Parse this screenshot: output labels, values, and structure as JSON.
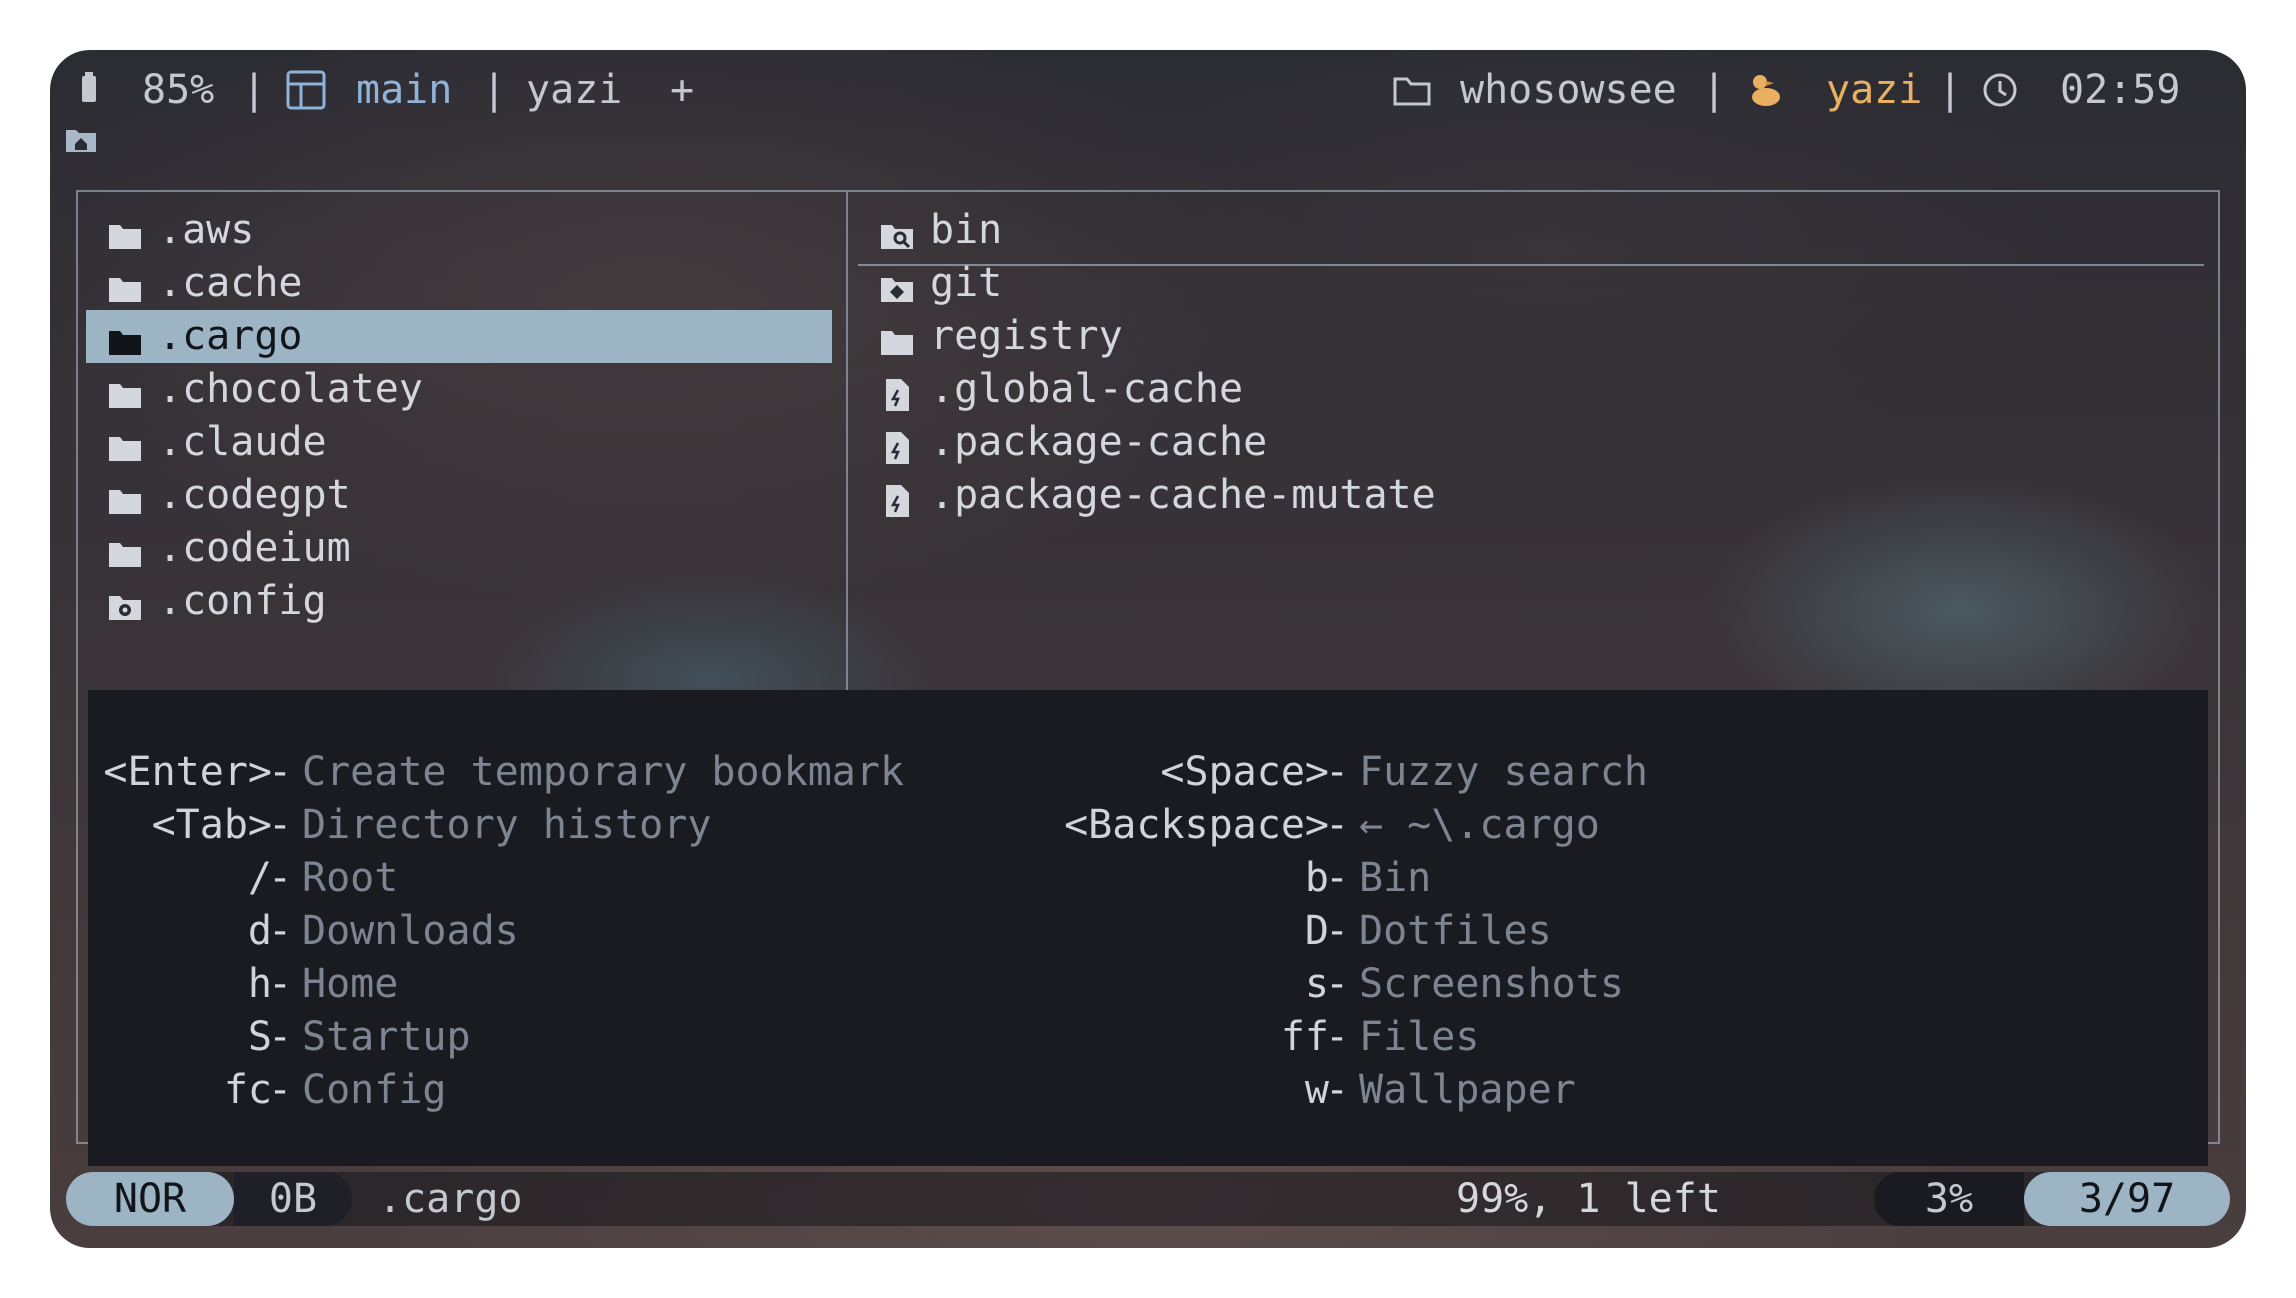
{
  "topbar": {
    "battery_icon": "battery-icon",
    "battery": "85%",
    "sep1": "|",
    "layout_icon": "layout-grid-icon",
    "session": "main",
    "sep2": "|",
    "tab": "yazi",
    "plus": "+",
    "folder_icon": "folder-outline-icon",
    "user": "whosowsee",
    "sep3": "|",
    "app_icon": "duck-icon",
    "app": "yazi",
    "sep4": "|",
    "clock_icon": "clock-icon",
    "time": "02:59"
  },
  "header": {
    "home_icon": "home-icon"
  },
  "left_pane": {
    "items": [
      {
        "name": ".aws",
        "icon": "folder-icon"
      },
      {
        "name": ".cache",
        "icon": "folder-icon"
      },
      {
        "name": ".cargo",
        "icon": "folder-icon",
        "selected": true
      },
      {
        "name": ".chocolatey",
        "icon": "folder-icon"
      },
      {
        "name": ".claude",
        "icon": "folder-icon"
      },
      {
        "name": ".codegpt",
        "icon": "folder-icon"
      },
      {
        "name": ".codeium",
        "icon": "folder-icon"
      },
      {
        "name": ".config",
        "icon": "folder-gear-icon"
      }
    ]
  },
  "right_pane": {
    "items": [
      {
        "name": "bin",
        "icon": "folder-search-icon"
      },
      {
        "name": "git",
        "icon": "folder-git-icon"
      },
      {
        "name": "registry",
        "icon": "folder-icon"
      },
      {
        "name": ".global-cache",
        "icon": "file-icon"
      },
      {
        "name": ".package-cache",
        "icon": "file-icon"
      },
      {
        "name": ".package-cache-mutate",
        "icon": "file-icon"
      }
    ]
  },
  "help": {
    "left": [
      {
        "key": "<Enter>",
        "dash": "-",
        "desc": "Create temporary bookmark"
      },
      {
        "key": "<Tab>",
        "dash": "-",
        "desc": "Directory history"
      },
      {
        "key": "/",
        "dash": "-",
        "desc": "Root"
      },
      {
        "key": "d",
        "dash": "-",
        "desc": "Downloads"
      },
      {
        "key": "h",
        "dash": "-",
        "desc": "Home"
      },
      {
        "key": "S",
        "dash": "-",
        "desc": "Startup"
      },
      {
        "key": "fc",
        "dash": "-",
        "desc": "Config"
      }
    ],
    "right": [
      {
        "key": "<Space>",
        "dash": "-",
        "desc": "Fuzzy search"
      },
      {
        "key": "<Backspace>",
        "dash": "-",
        "desc": "← ~\\.cargo"
      },
      {
        "key": "b",
        "dash": "-",
        "desc": "Bin"
      },
      {
        "key": "D",
        "dash": "-",
        "desc": "Dotfiles"
      },
      {
        "key": "s",
        "dash": "-",
        "desc": "Screenshots"
      },
      {
        "key": "ff",
        "dash": "-",
        "desc": "Files"
      },
      {
        "key": "w",
        "dash": "-",
        "desc": "Wallpaper"
      }
    ]
  },
  "status": {
    "mode": "NOR",
    "size": "0B",
    "name": ".cargo",
    "progress": "99%, 1 left",
    "percent": "3%",
    "position": "3/97"
  }
}
